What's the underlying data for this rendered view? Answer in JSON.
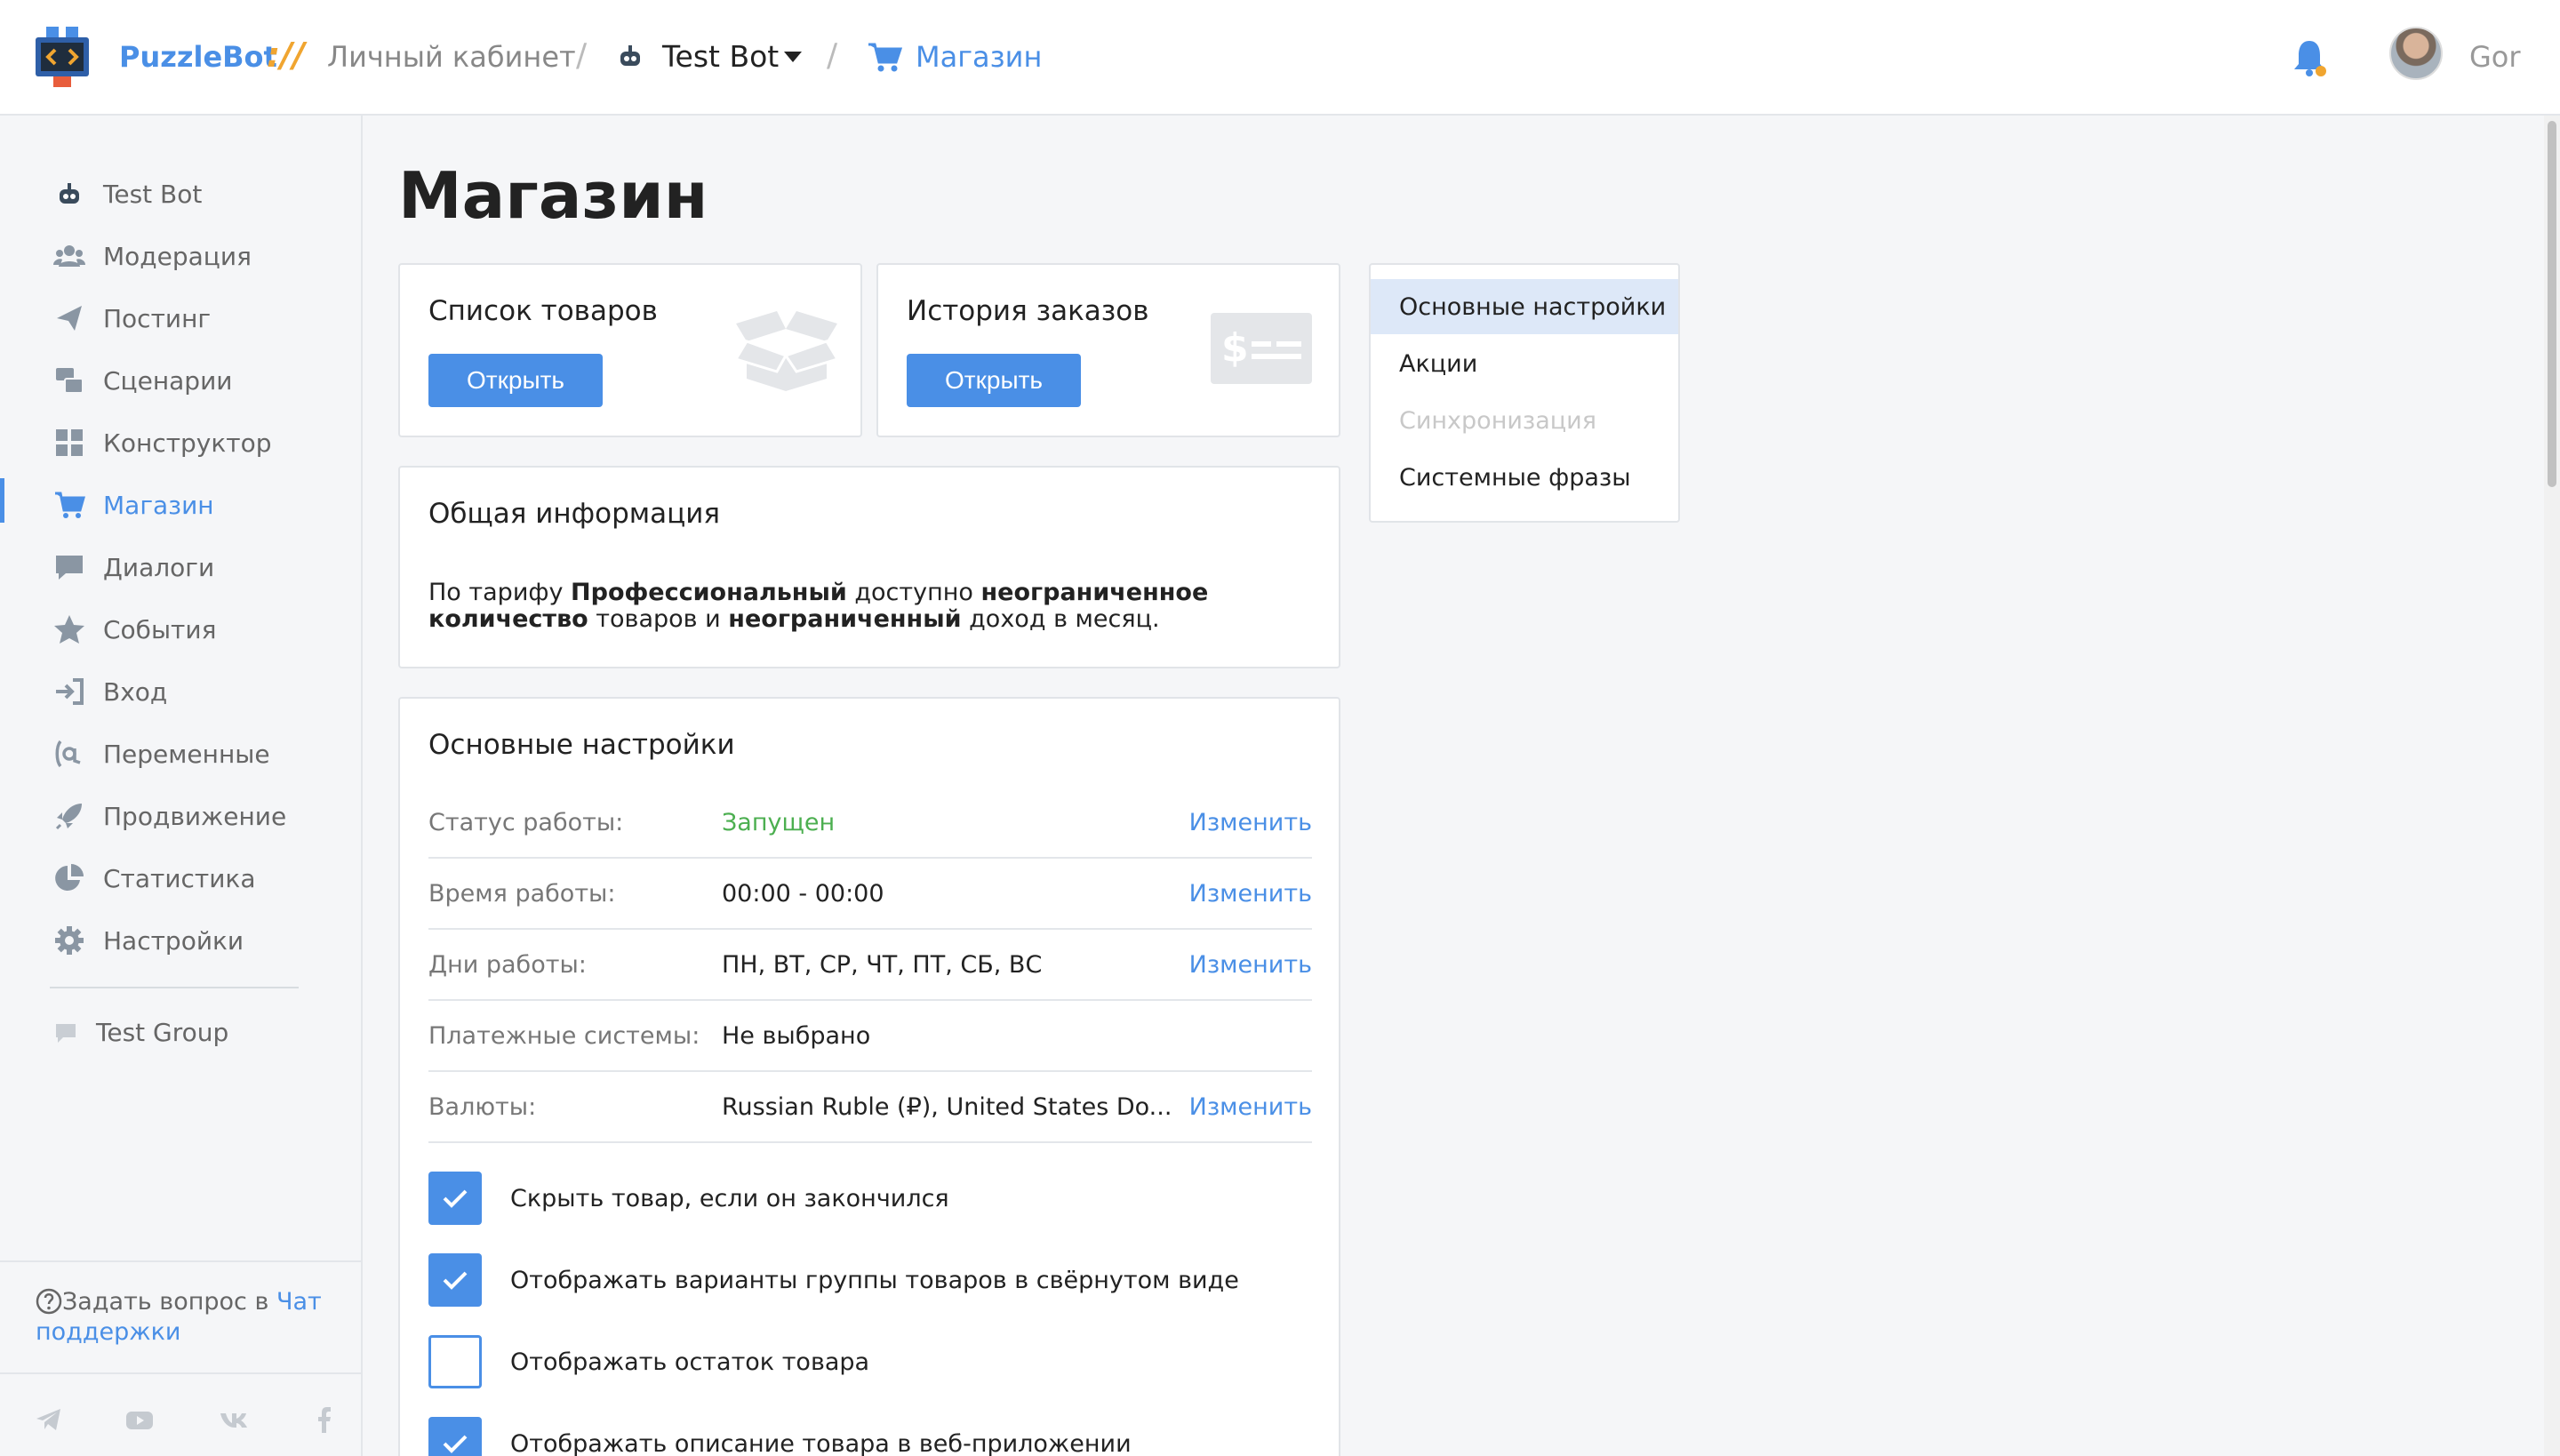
{
  "header": {
    "brand": "PuzzleBot",
    "brand_separator": "://",
    "cabinet": "Личный кабинет",
    "bot_name": "Test Bot",
    "current": "Магазин",
    "user_name": "Gor"
  },
  "sidebar": {
    "items": [
      {
        "label": "Test Bot",
        "icon": "bot-icon"
      },
      {
        "label": "Модерация",
        "icon": "users-icon"
      },
      {
        "label": "Постинг",
        "icon": "paper-plane-icon"
      },
      {
        "label": "Сценарии",
        "icon": "scenario-icon"
      },
      {
        "label": "Конструктор",
        "icon": "grid-icon"
      },
      {
        "label": "Магазин",
        "icon": "cart-icon"
      },
      {
        "label": "Диалоги",
        "icon": "comment-icon"
      },
      {
        "label": "События",
        "icon": "star-icon"
      },
      {
        "label": "Вход",
        "icon": "sign-in-icon"
      },
      {
        "label": "Переменные",
        "icon": "variable-icon"
      },
      {
        "label": "Продвижение",
        "icon": "rocket-icon"
      },
      {
        "label": "Статистика",
        "icon": "pie-chart-icon"
      },
      {
        "label": "Настройки",
        "icon": "gear-icon"
      }
    ],
    "group": {
      "label": "Test Group",
      "icon": "chat-bubble-icon"
    },
    "help_prefix": "Задать вопрос в",
    "help_link": "Чат поддержки"
  },
  "main": {
    "title": "Магазин",
    "products_card": {
      "title": "Список товаров",
      "button": "Открыть"
    },
    "orders_card": {
      "title": "История заказов",
      "button": "Открыть"
    },
    "info": {
      "title": "Общая информация",
      "t1": "По тарифу ",
      "b1": "Профессиональный",
      "t2": " доступно ",
      "b2": "неограниченное количество",
      "t3": " товаров и ",
      "b3": "неограниченный",
      "t4": " доход в месяц."
    },
    "settings": {
      "title": "Основные настройки",
      "change_label": "Изменить",
      "rows": [
        {
          "label": "Статус работы:",
          "value": "Запущен"
        },
        {
          "label": "Время работы:",
          "value": "00:00 - 00:00"
        },
        {
          "label": "Дни работы:",
          "value": "ПН, ВТ, СР, ЧТ, ПТ, СБ, ВС"
        },
        {
          "label": "Платежные системы:",
          "value": "Не выбрано"
        },
        {
          "label": "Валюты:",
          "value": "Russian Ruble (₽), United States Do..."
        }
      ],
      "checks": [
        {
          "label": "Скрыть товар, если он закончился",
          "checked": true
        },
        {
          "label": "Отображать варианты группы товаров в свёрнутом виде",
          "checked": true
        },
        {
          "label": "Отображать остаток товара",
          "checked": false
        },
        {
          "label": "Отображать описание товара в веб-приложении",
          "checked": true
        }
      ]
    }
  },
  "right_menu": {
    "items": [
      {
        "label": "Основные настройки",
        "state": "selected"
      },
      {
        "label": "Акции",
        "state": "normal"
      },
      {
        "label": "Синхронизация",
        "state": "disabled"
      },
      {
        "label": "Системные фразы",
        "state": "normal"
      }
    ]
  },
  "colors": {
    "accent": "#4a8fe6",
    "success": "#4caf50",
    "brand_sep": "#f0a530"
  }
}
